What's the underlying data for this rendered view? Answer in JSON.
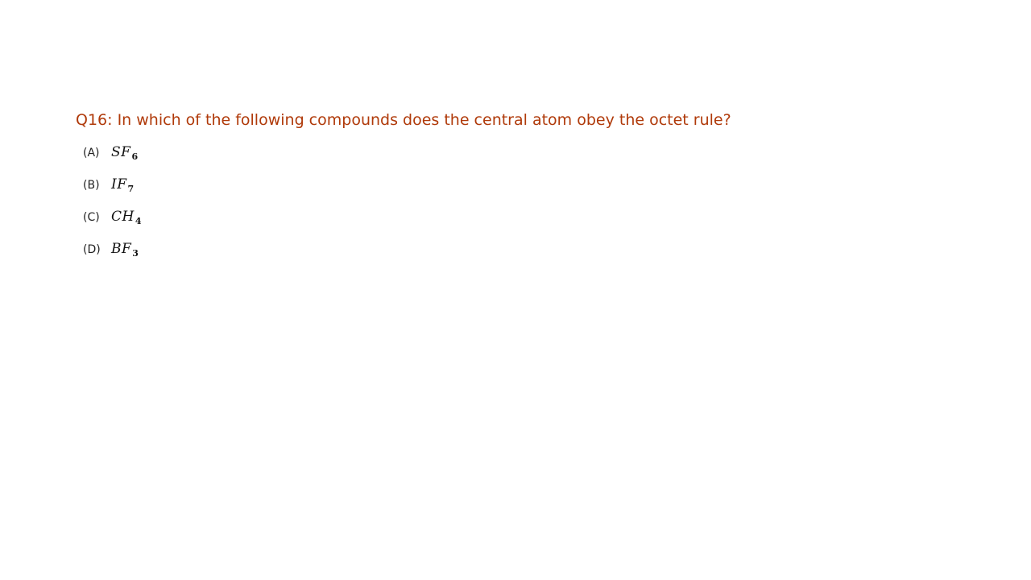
{
  "question": {
    "text": "Q16: In which of the following compounds does the central atom obey the octet rule?"
  },
  "options": [
    {
      "letter": "(A)",
      "formula_main": "SF",
      "formula_sub": "6"
    },
    {
      "letter": "(B)",
      "formula_main": "IF",
      "formula_sub": "7"
    },
    {
      "letter": "(C)",
      "formula_main": "CH",
      "formula_sub": "4"
    },
    {
      "letter": "(D)",
      "formula_main": "BF",
      "formula_sub": "3"
    }
  ],
  "colors": {
    "question_text": "#b03a0a",
    "option_text": "#222222"
  }
}
